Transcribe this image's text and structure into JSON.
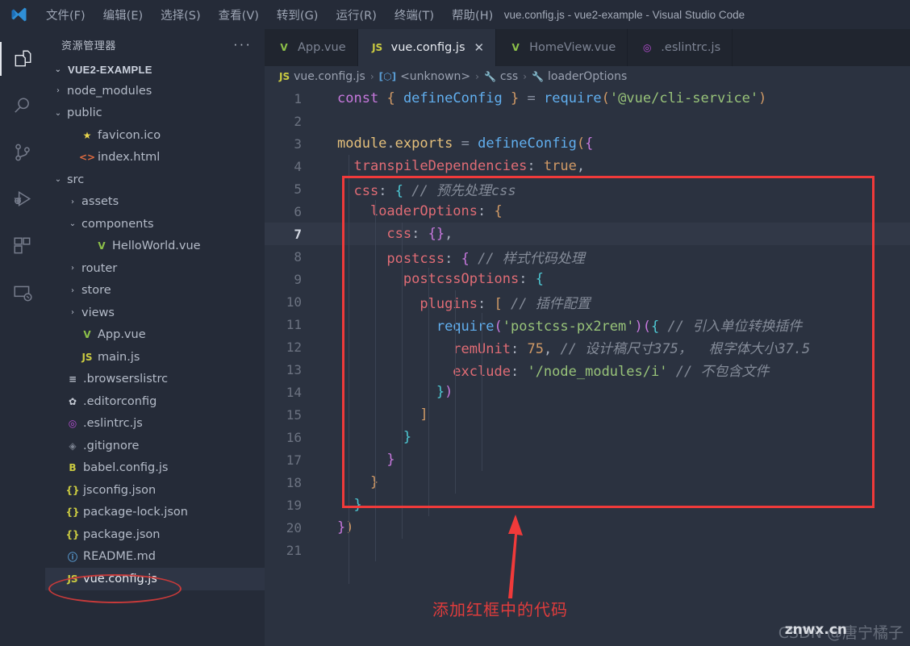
{
  "window": {
    "title": "vue.config.js - vue2-example - Visual Studio Code",
    "logo_icon": "vscode-logo-icon"
  },
  "menubar": {
    "items": [
      {
        "label": "文件(F)",
        "name": "menu-file"
      },
      {
        "label": "编辑(E)",
        "name": "menu-edit"
      },
      {
        "label": "选择(S)",
        "name": "menu-selection"
      },
      {
        "label": "查看(V)",
        "name": "menu-view"
      },
      {
        "label": "转到(G)",
        "name": "menu-go"
      },
      {
        "label": "运行(R)",
        "name": "menu-run"
      },
      {
        "label": "终端(T)",
        "name": "menu-terminal"
      },
      {
        "label": "帮助(H)",
        "name": "menu-help"
      }
    ]
  },
  "activitybar": {
    "items": [
      {
        "name": "explorer-icon",
        "active": true
      },
      {
        "name": "search-icon",
        "active": false
      },
      {
        "name": "source-control-icon",
        "active": false
      },
      {
        "name": "run-and-debug-icon",
        "active": false
      },
      {
        "name": "extensions-icon",
        "active": false
      },
      {
        "name": "remote-explorer-icon",
        "active": false
      }
    ]
  },
  "sidebar": {
    "title": "资源管理器",
    "more_actions": "···",
    "root_label": "VUE2-EXAMPLE",
    "items": [
      {
        "label": "node_modules",
        "indent": 1,
        "chev": "›",
        "icon": "",
        "icon_color": "",
        "selected": false
      },
      {
        "label": "public",
        "indent": 1,
        "chev": "⌄",
        "icon": "",
        "icon_color": "",
        "selected": false
      },
      {
        "label": "favicon.ico",
        "indent": 2,
        "chev": "",
        "icon": "★",
        "icon_color": "#e8d44d",
        "selected": false
      },
      {
        "label": "index.html",
        "indent": 2,
        "chev": "",
        "icon": "<>",
        "icon_color": "#e06c40",
        "selected": false
      },
      {
        "label": "src",
        "indent": 1,
        "chev": "⌄",
        "icon": "",
        "icon_color": "",
        "selected": false
      },
      {
        "label": "assets",
        "indent": 2,
        "chev": "›",
        "icon": "",
        "icon_color": "",
        "selected": false
      },
      {
        "label": "components",
        "indent": 2,
        "chev": "⌄",
        "icon": "",
        "icon_color": "",
        "selected": false
      },
      {
        "label": "HelloWorld.vue",
        "indent": 3,
        "chev": "",
        "icon": "V",
        "icon_color": "#8dc149",
        "selected": false
      },
      {
        "label": "router",
        "indent": 2,
        "chev": "›",
        "icon": "",
        "icon_color": "",
        "selected": false
      },
      {
        "label": "store",
        "indent": 2,
        "chev": "›",
        "icon": "",
        "icon_color": "",
        "selected": false
      },
      {
        "label": "views",
        "indent": 2,
        "chev": "›",
        "icon": "",
        "icon_color": "",
        "selected": false
      },
      {
        "label": "App.vue",
        "indent": 2,
        "chev": "",
        "icon": "V",
        "icon_color": "#8dc149",
        "selected": false
      },
      {
        "label": "main.js",
        "indent": 2,
        "chev": "",
        "icon": "JS",
        "icon_color": "#cbcb41",
        "selected": false
      },
      {
        "label": ".browserslistrc",
        "indent": 1,
        "chev": "",
        "icon": "≡",
        "icon_color": "#b6bcc8",
        "selected": false
      },
      {
        "label": ".editorconfig",
        "indent": 1,
        "chev": "",
        "icon": "✿",
        "icon_color": "#c5cad4",
        "selected": false
      },
      {
        "label": ".eslintrc.js",
        "indent": 1,
        "chev": "",
        "icon": "◎",
        "icon_color": "#b94fd6",
        "selected": false
      },
      {
        "label": ".gitignore",
        "indent": 1,
        "chev": "",
        "icon": "◈",
        "icon_color": "#7b8290",
        "selected": false
      },
      {
        "label": "babel.config.js",
        "indent": 1,
        "chev": "",
        "icon": "B",
        "icon_color": "#cbcb41",
        "selected": false
      },
      {
        "label": "jsconfig.json",
        "indent": 1,
        "chev": "",
        "icon": "{}",
        "icon_color": "#cbcb41",
        "selected": false
      },
      {
        "label": "package-lock.json",
        "indent": 1,
        "chev": "",
        "icon": "{}",
        "icon_color": "#cbcb41",
        "selected": false
      },
      {
        "label": "package.json",
        "indent": 1,
        "chev": "",
        "icon": "{}",
        "icon_color": "#cbcb41",
        "selected": false
      },
      {
        "label": "README.md",
        "indent": 1,
        "chev": "",
        "icon": "ⓘ",
        "icon_color": "#5a9ed6",
        "selected": false
      },
      {
        "label": "vue.config.js",
        "indent": 1,
        "chev": "",
        "icon": "JS",
        "icon_color": "#cbcb41",
        "selected": true
      }
    ]
  },
  "tabs": [
    {
      "label": "App.vue",
      "icon": "V",
      "icon_color": "#8dc149",
      "active": false,
      "closable": false
    },
    {
      "label": "vue.config.js",
      "icon": "JS",
      "icon_color": "#cbcb41",
      "active": true,
      "closable": true,
      "close_glyph": "✕"
    },
    {
      "label": "HomeView.vue",
      "icon": "V",
      "icon_color": "#8dc149",
      "active": false,
      "closable": false
    },
    {
      "label": ".eslintrc.js",
      "icon": "◎",
      "icon_color": "#b94fd6",
      "active": false,
      "closable": false
    }
  ],
  "breadcrumb": {
    "items": [
      {
        "label": "vue.config.js",
        "icon": "JS",
        "icon_color": "#cbcb41"
      },
      {
        "label": "<unknown>",
        "icon": "[⬡]",
        "icon_color": "#5a9ed6"
      },
      {
        "label": "css",
        "icon": "🔧",
        "icon_color": "#c9a45a"
      },
      {
        "label": "loaderOptions",
        "icon": "🔧",
        "icon_color": "#c9a45a"
      }
    ],
    "separator": "›"
  },
  "editor": {
    "active_line": 7,
    "lines": [
      {
        "n": 1,
        "tokens": [
          {
            "t": "const",
            "c": "t-kw"
          },
          {
            "t": " ",
            "c": "t-plain"
          },
          {
            "t": "{",
            "c": "t-b1"
          },
          {
            "t": " ",
            "c": "t-plain"
          },
          {
            "t": "defineConfig",
            "c": "t-fn"
          },
          {
            "t": " ",
            "c": "t-plain"
          },
          {
            "t": "}",
            "c": "t-b1"
          },
          {
            "t": " ",
            "c": "t-plain"
          },
          {
            "t": "=",
            "c": "t-op"
          },
          {
            "t": " ",
            "c": "t-plain"
          },
          {
            "t": "require",
            "c": "t-fn"
          },
          {
            "t": "(",
            "c": "t-b1"
          },
          {
            "t": "'@vue/cli-service'",
            "c": "t-str"
          },
          {
            "t": ")",
            "c": "t-b1"
          }
        ]
      },
      {
        "n": 2,
        "tokens": []
      },
      {
        "n": 3,
        "tokens": [
          {
            "t": "module",
            "c": "t-pl"
          },
          {
            "t": ".",
            "c": "t-plain"
          },
          {
            "t": "exports",
            "c": "t-pl"
          },
          {
            "t": " ",
            "c": "t-plain"
          },
          {
            "t": "=",
            "c": "t-op"
          },
          {
            "t": " ",
            "c": "t-plain"
          },
          {
            "t": "defineConfig",
            "c": "t-fn"
          },
          {
            "t": "(",
            "c": "t-b1"
          },
          {
            "t": "{",
            "c": "t-b2"
          }
        ]
      },
      {
        "n": 4,
        "tokens": [
          {
            "t": "  ",
            "c": "t-plain"
          },
          {
            "t": "transpileDependencies",
            "c": "t-prop"
          },
          {
            "t": ":",
            "c": "t-plain"
          },
          {
            "t": " ",
            "c": "t-plain"
          },
          {
            "t": "true",
            "c": "t-num"
          },
          {
            "t": ",",
            "c": "t-plain"
          }
        ]
      },
      {
        "n": 5,
        "tokens": [
          {
            "t": "  ",
            "c": "t-plain"
          },
          {
            "t": "css",
            "c": "t-prop"
          },
          {
            "t": ":",
            "c": "t-plain"
          },
          {
            "t": " ",
            "c": "t-plain"
          },
          {
            "t": "{",
            "c": "t-b3"
          },
          {
            "t": " ",
            "c": "t-plain"
          },
          {
            "t": "// 预先处理css",
            "c": "t-cm"
          }
        ]
      },
      {
        "n": 6,
        "tokens": [
          {
            "t": "    ",
            "c": "t-plain"
          },
          {
            "t": "loaderOptions",
            "c": "t-prop"
          },
          {
            "t": ":",
            "c": "t-plain"
          },
          {
            "t": " ",
            "c": "t-plain"
          },
          {
            "t": "{",
            "c": "t-b1"
          }
        ]
      },
      {
        "n": 7,
        "tokens": [
          {
            "t": "      ",
            "c": "t-plain"
          },
          {
            "t": "css",
            "c": "t-prop"
          },
          {
            "t": ":",
            "c": "t-plain"
          },
          {
            "t": " ",
            "c": "t-plain"
          },
          {
            "t": "{}",
            "c": "t-b2"
          },
          {
            "t": ",",
            "c": "t-plain"
          }
        ]
      },
      {
        "n": 8,
        "tokens": [
          {
            "t": "      ",
            "c": "t-plain"
          },
          {
            "t": "postcss",
            "c": "t-prop"
          },
          {
            "t": ":",
            "c": "t-plain"
          },
          {
            "t": " ",
            "c": "t-plain"
          },
          {
            "t": "{",
            "c": "t-b2"
          },
          {
            "t": " ",
            "c": "t-plain"
          },
          {
            "t": "// 样式代码处理",
            "c": "t-cm"
          }
        ]
      },
      {
        "n": 9,
        "tokens": [
          {
            "t": "        ",
            "c": "t-plain"
          },
          {
            "t": "postcssOptions",
            "c": "t-prop"
          },
          {
            "t": ":",
            "c": "t-plain"
          },
          {
            "t": " ",
            "c": "t-plain"
          },
          {
            "t": "{",
            "c": "t-b3"
          }
        ]
      },
      {
        "n": 10,
        "tokens": [
          {
            "t": "          ",
            "c": "t-plain"
          },
          {
            "t": "plugins",
            "c": "t-prop"
          },
          {
            "t": ":",
            "c": "t-plain"
          },
          {
            "t": " ",
            "c": "t-plain"
          },
          {
            "t": "[",
            "c": "t-b1"
          },
          {
            "t": " ",
            "c": "t-plain"
          },
          {
            "t": "// 插件配置",
            "c": "t-cm"
          }
        ]
      },
      {
        "n": 11,
        "tokens": [
          {
            "t": "            ",
            "c": "t-plain"
          },
          {
            "t": "require",
            "c": "t-fn"
          },
          {
            "t": "(",
            "c": "t-b2"
          },
          {
            "t": "'postcss-px2rem'",
            "c": "t-str"
          },
          {
            "t": ")",
            "c": "t-b2"
          },
          {
            "t": "(",
            "c": "t-b2"
          },
          {
            "t": "{",
            "c": "t-b3"
          },
          {
            "t": " ",
            "c": "t-plain"
          },
          {
            "t": "// 引入单位转换插件",
            "c": "t-cm"
          }
        ]
      },
      {
        "n": 12,
        "tokens": [
          {
            "t": "              ",
            "c": "t-plain"
          },
          {
            "t": "remUnit",
            "c": "t-prop"
          },
          {
            "t": ":",
            "c": "t-plain"
          },
          {
            "t": " ",
            "c": "t-plain"
          },
          {
            "t": "75",
            "c": "t-num"
          },
          {
            "t": ",",
            "c": "t-plain"
          },
          {
            "t": " ",
            "c": "t-plain"
          },
          {
            "t": "// 设计稿尺寸375，  根字体大小37.5",
            "c": "t-cm"
          }
        ]
      },
      {
        "n": 13,
        "tokens": [
          {
            "t": "              ",
            "c": "t-plain"
          },
          {
            "t": "exclude",
            "c": "t-prop"
          },
          {
            "t": ":",
            "c": "t-plain"
          },
          {
            "t": " ",
            "c": "t-plain"
          },
          {
            "t": "'/node_modules/i'",
            "c": "t-str"
          },
          {
            "t": " ",
            "c": "t-plain"
          },
          {
            "t": "// 不包含文件",
            "c": "t-cm"
          }
        ]
      },
      {
        "n": 14,
        "tokens": [
          {
            "t": "            ",
            "c": "t-plain"
          },
          {
            "t": "}",
            "c": "t-b3"
          },
          {
            "t": ")",
            "c": "t-b2"
          }
        ]
      },
      {
        "n": 15,
        "tokens": [
          {
            "t": "          ",
            "c": "t-plain"
          },
          {
            "t": "]",
            "c": "t-b1"
          }
        ]
      },
      {
        "n": 16,
        "tokens": [
          {
            "t": "        ",
            "c": "t-plain"
          },
          {
            "t": "}",
            "c": "t-b3"
          }
        ]
      },
      {
        "n": 17,
        "tokens": [
          {
            "t": "      ",
            "c": "t-plain"
          },
          {
            "t": "}",
            "c": "t-b2"
          }
        ]
      },
      {
        "n": 18,
        "tokens": [
          {
            "t": "    ",
            "c": "t-plain"
          },
          {
            "t": "}",
            "c": "t-b1"
          }
        ]
      },
      {
        "n": 19,
        "tokens": [
          {
            "t": "  ",
            "c": "t-plain"
          },
          {
            "t": "}",
            "c": "t-b3"
          }
        ]
      },
      {
        "n": 20,
        "tokens": [
          {
            "t": "}",
            "c": "t-b2"
          },
          {
            "t": ")",
            "c": "t-b1"
          }
        ]
      },
      {
        "n": 21,
        "tokens": []
      }
    ]
  },
  "annotations": {
    "note_text": "添加红框中的代码",
    "highlight_color": "#f03a3a",
    "ellipse_color": "#c73a3a"
  },
  "watermark": {
    "text": "CSDN @唐宁橘子",
    "overlay": "znwx.cn"
  }
}
